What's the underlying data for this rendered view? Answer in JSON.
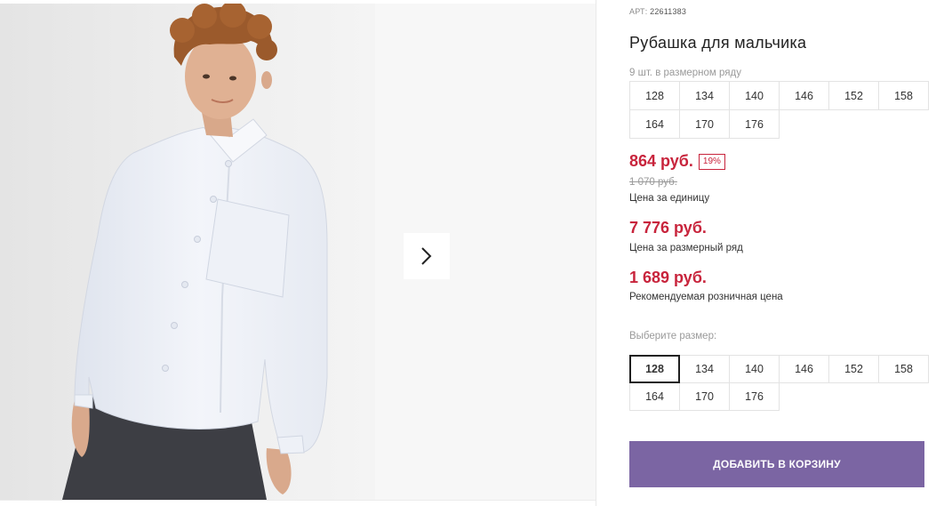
{
  "product": {
    "sku_label": "АРТ:",
    "sku_value": "22611383",
    "title": "Рубашка для мальчика"
  },
  "size_row": {
    "note": "9 шт. в размерном ряду",
    "sizes": [
      "128",
      "134",
      "140",
      "146",
      "152",
      "158",
      "164",
      "170",
      "176"
    ]
  },
  "pricing": {
    "unit_price": "864 руб.",
    "discount_badge": "19%",
    "old_price": "1 070 руб.",
    "unit_label": "Цена за единицу",
    "pack_price": "7 776 руб.",
    "pack_label": "Цена за размерный ряд",
    "retail_price": "1 689 руб.",
    "retail_label": "Рекомендуемая розничная цена",
    "price_color": "#c8243c"
  },
  "size_select": {
    "label": "Выберите размер:",
    "selected": "128",
    "sizes": [
      "128",
      "134",
      "140",
      "146",
      "152",
      "158",
      "164",
      "170",
      "176"
    ]
  },
  "cart": {
    "button_label": "ДОБАВИТЬ В КОРЗИНУ",
    "button_color": "#7b65a3"
  },
  "gallery": {
    "next_icon": "chevron-right-icon"
  }
}
